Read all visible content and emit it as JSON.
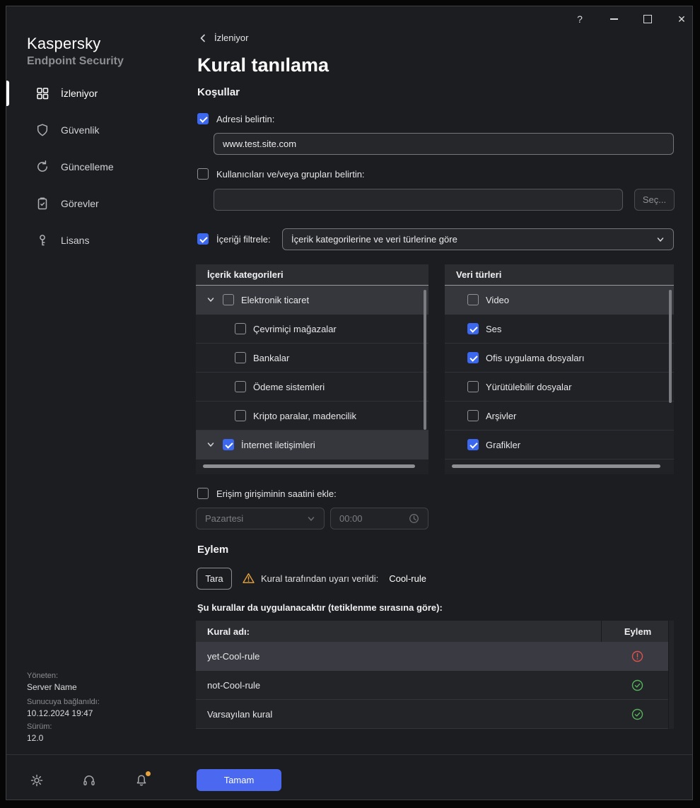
{
  "window": {
    "help_label": "?"
  },
  "sidebar": {
    "brand_line1": "Kaspersky",
    "brand_line2": "Endpoint Security",
    "items": [
      {
        "label": "İzleniyor",
        "icon": "dashboard-grid-icon",
        "selected": true
      },
      {
        "label": "Güvenlik",
        "icon": "shield-icon",
        "selected": false
      },
      {
        "label": "Güncelleme",
        "icon": "refresh-icon",
        "selected": false
      },
      {
        "label": "Görevler",
        "icon": "tasks-icon",
        "selected": false
      },
      {
        "label": "Lisans",
        "icon": "key-icon",
        "selected": false
      }
    ],
    "footer": {
      "managed_label": "Yöneten:",
      "server_name": "Server Name",
      "connected_label": "Sunucuya bağlanıldı:",
      "connected_time": "10.12.2024 19:47",
      "version_label": "Sürüm:",
      "version_value": "12.0"
    }
  },
  "main": {
    "breadcrumb": "İzleniyor",
    "title": "Kural tanılama",
    "sections": {
      "conditions": "Koşullar",
      "action": "Eylem"
    },
    "address": {
      "label": "Adresi belirtin:",
      "checked": true,
      "value": "www.test.site.com"
    },
    "users": {
      "label": "Kullanıcıları ve/veya grupları belirtin:",
      "checked": false,
      "value": "",
      "select_button": "Seç..."
    },
    "filter": {
      "label": "İçeriği filtrele:",
      "checked": true,
      "dropdown_value": "İçerik kategorilerine ve veri türlerine göre"
    },
    "categories": {
      "header": "İçerik kategorileri",
      "items": [
        {
          "label": "Elektronik ticaret",
          "checked": false,
          "expandable": true,
          "highlighted": true
        },
        {
          "label": "Çevrimiçi mağazalar",
          "checked": false
        },
        {
          "label": "Bankalar",
          "checked": false
        },
        {
          "label": "Ödeme sistemleri",
          "checked": false
        },
        {
          "label": "Kripto paralar, madencilik",
          "checked": false
        },
        {
          "label": "İnternet iletişimleri",
          "checked": true,
          "expandable": true,
          "highlighted": true
        }
      ]
    },
    "data_types": {
      "header": "Veri türleri",
      "items": [
        {
          "label": "Video",
          "checked": false,
          "highlighted": true
        },
        {
          "label": "Ses",
          "checked": true
        },
        {
          "label": "Ofis uygulama dosyaları",
          "checked": true
        },
        {
          "label": "Yürütülebilir dosyalar",
          "checked": false
        },
        {
          "label": "Arşivler",
          "checked": false
        },
        {
          "label": "Grafikler",
          "checked": true
        }
      ]
    },
    "time": {
      "label": "Erişim girişiminin saatini ekle:",
      "checked": false,
      "day": "Pazartesi",
      "time": "00:00"
    },
    "action": {
      "scan_button": "Tara",
      "warning_text": "Kural tarafından uyarı verildi:",
      "rule_name": "Cool-rule"
    },
    "rules": {
      "heading": "Şu kurallar da uygulanacaktır (tetiklenme sırasına göre):",
      "col_name": "Kural adı:",
      "col_action": "Eylem",
      "rows": [
        {
          "name": "yet-Cool-rule",
          "status": "warning",
          "highlighted": true
        },
        {
          "name": "not-Cool-rule",
          "status": "ok",
          "highlighted": false
        },
        {
          "name": "Varsayılan kural",
          "status": "ok",
          "highlighted": false
        }
      ]
    },
    "ok_button": "Tamam"
  }
}
